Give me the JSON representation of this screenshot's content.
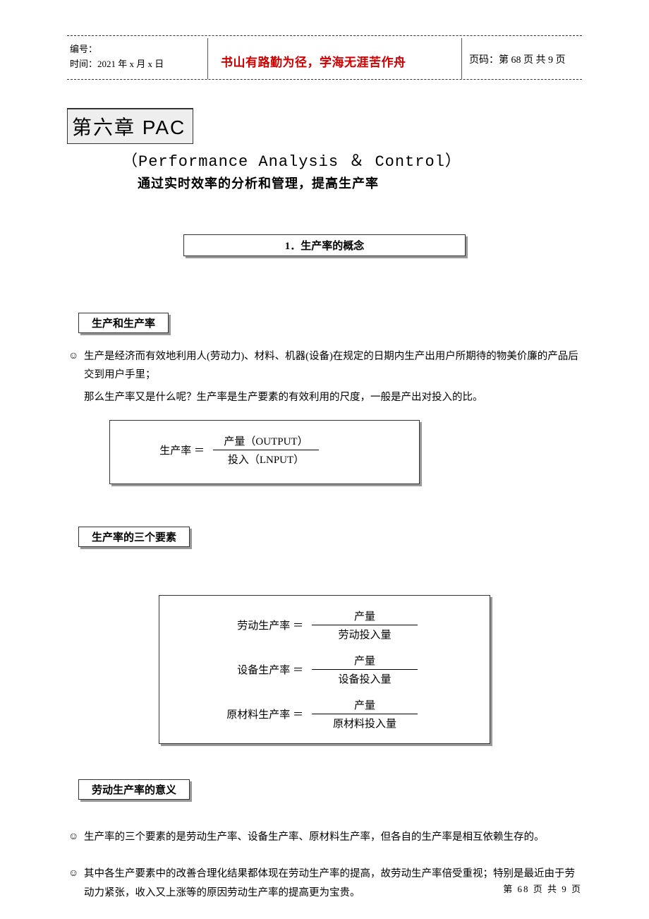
{
  "header": {
    "bianhao_label": "编号：",
    "date_line": "时间：2021 年 x 月 x 日",
    "motto": "书山有路勤为径，学海无涯苦作舟",
    "page_label": "页码：第 68 页 共 9 页"
  },
  "chapter": {
    "title": "第六章 PAC",
    "subtitle_en": "（Performance Analysis ＆  Control）",
    "subtitle_cn": "通过实时效率的分析和管理，提高生产率"
  },
  "section1": {
    "title": "1．生产率的概念"
  },
  "block1": {
    "label": "生产和生产率",
    "bullet": "生产是经济而有效地利用人(劳动力)、材料、机器(设备)在规定的日期内生产出用户所期待的物美价廉的产品后交到用户手里；",
    "line2": "那么生产率又是什么呢？生产率是生产要素的有效利用的尺度，一般是产出对投入的比。",
    "formula": {
      "lhs": "生产率 ＝",
      "top": "产量（OUTPUT）",
      "bot": "投入（LNPUT）"
    }
  },
  "block2": {
    "label": "生产率的三个要素",
    "formulas": [
      {
        "lhs": "劳动生产率 ＝",
        "top": "产量",
        "bot": "劳动投入量"
      },
      {
        "lhs": "设备生产率 ＝",
        "top": "产量",
        "bot": "设备投入量"
      },
      {
        "lhs": "原材料生产率 ＝",
        "top": "产量",
        "bot": "原材料投入量"
      }
    ]
  },
  "block3": {
    "label": "劳动生产率的意义",
    "bullet1": "生产率的三个要素的是劳动生产率、设备生产率、原材料生产率，但各自的生产率是相互依赖生存的。",
    "bullet2": "其中各生产要素中的改善合理化结果都体现在劳动生产率的提高，故劳动生产率倍受重视；特别是最近由于劳动力紧张，收入又上涨等的原因劳动生产率的提高更为宝贵。"
  },
  "footer": {
    "text": "第 68 页 共 9 页"
  },
  "icons": {
    "smile": "☺"
  }
}
